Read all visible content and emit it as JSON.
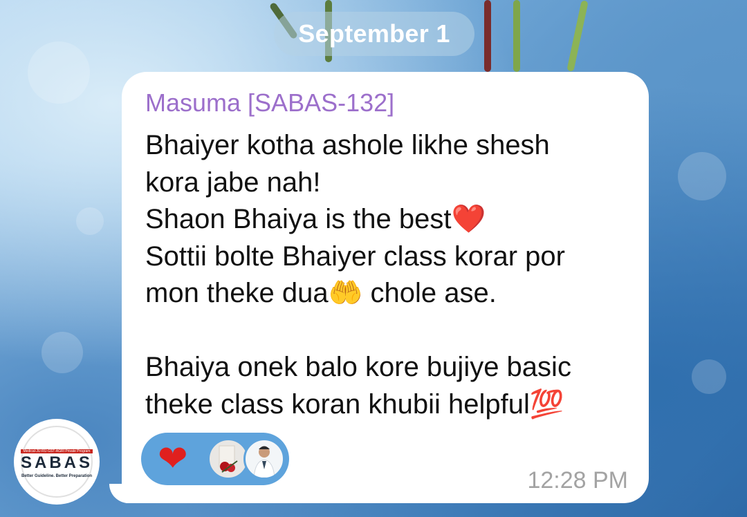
{
  "date_separator": "September 1",
  "message": {
    "sender": "Masuma [SABAS-132]",
    "lines": [
      "Bhaiyer kotha  ashole likhe shesh",
      "kora jabe nah!",
      "Shaon Bhaiya is the best❤️",
      "Sottii bolte Bhaiyer class korar por",
      "mon theke dua🤲 chole ase.",
      "",
      "Bhaiya onek balo kore bujiye basic",
      "theke class koran khubii helpful💯"
    ],
    "time": "12:28 PM"
  },
  "reactions": {
    "emoji": "❤",
    "reactor_avatars": [
      "avatar-roses",
      "avatar-doctor"
    ]
  },
  "channel_logo": {
    "banner": "Medical-JU-RU-GST-AGRI Private Program",
    "name": "SABAS",
    "tagline": "Better Guideline. Better Preparation"
  },
  "colors": {
    "sender_name": "#9c6fcb",
    "reaction_pill": "#5ea3dc",
    "time": "#a3a3a3",
    "bubble": "#ffffff"
  }
}
